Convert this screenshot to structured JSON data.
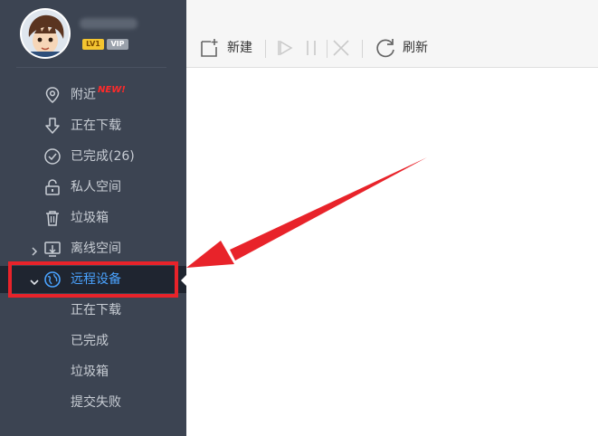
{
  "user": {
    "level_badge": "LV1",
    "vip_badge": "VIP"
  },
  "nav": {
    "nearby": "附近",
    "new_tag": "NEW!",
    "downloading": "正在下载",
    "completed": "已完成(26)",
    "private_space": "私人空间",
    "trash": "垃圾箱",
    "offline_space": "离线空间",
    "remote_device": "远程设备",
    "remote_sub": [
      "正在下载",
      "已完成",
      "垃圾箱",
      "提交失败"
    ]
  },
  "toolbar": {
    "new_label": "新建",
    "refresh_label": "刷新"
  },
  "colors": {
    "sidebar": "#3c4452",
    "active_text": "#4aa3ff",
    "highlight": "#e8232a"
  }
}
